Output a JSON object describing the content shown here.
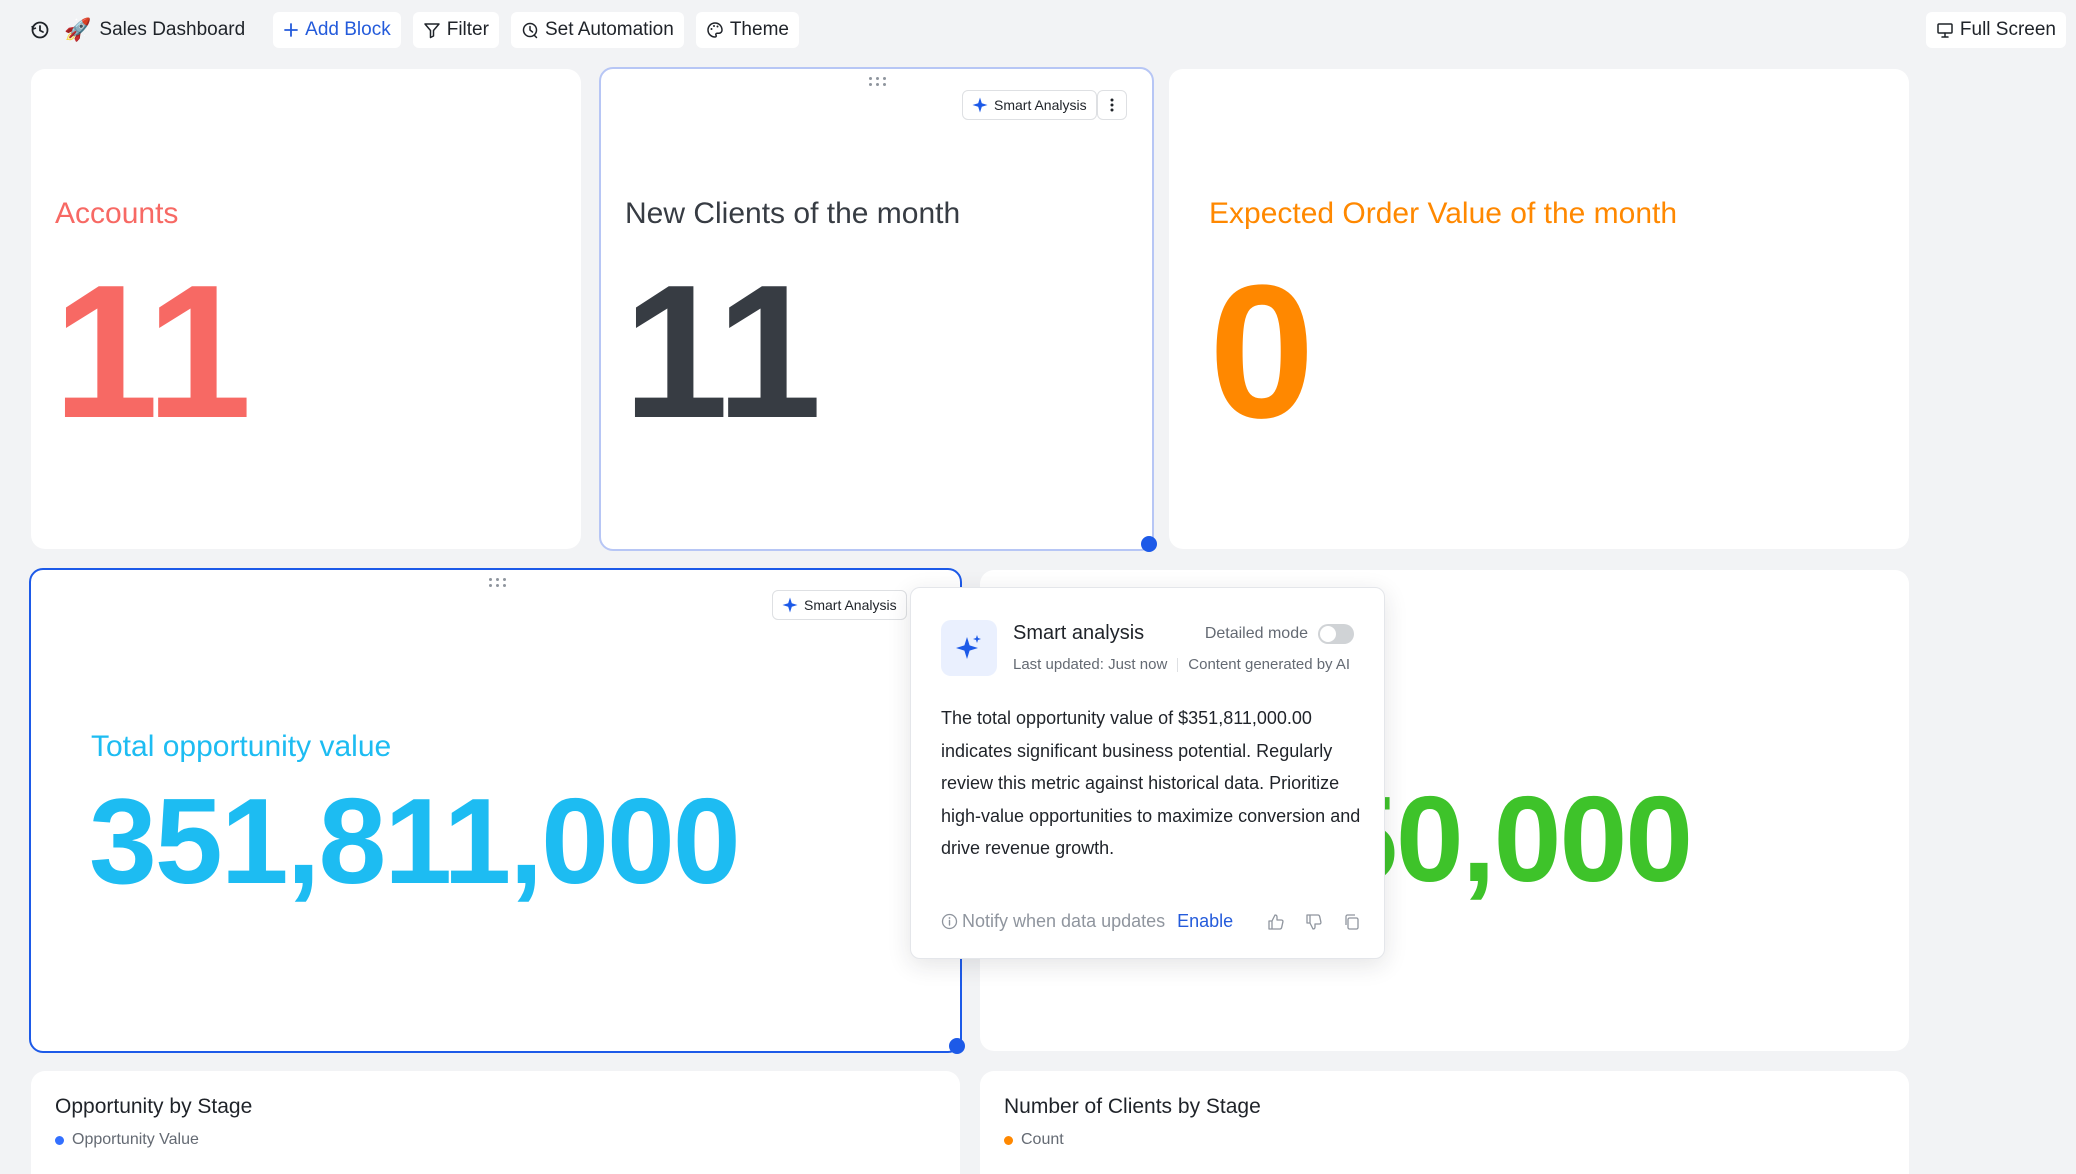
{
  "toolbar": {
    "dashboard_title": "Sales Dashboard",
    "add_block": "Add Block",
    "filter": "Filter",
    "set_automation": "Set Automation",
    "theme": "Theme",
    "full_screen": "Full Screen"
  },
  "kpis": [
    {
      "title": "Accounts",
      "value": "11",
      "color": "#f76964"
    },
    {
      "title": "New Clients of the month",
      "value": "11",
      "color": "#373c43"
    },
    {
      "title": "Expected Order Value of the month",
      "value": "0",
      "color": "#ff8800"
    },
    {
      "title": "Total opportunity value",
      "value": "351,811,000",
      "color": "#1dbcf2"
    },
    {
      "title": "",
      "value": "50,000",
      "color": "#3ec32a"
    }
  ],
  "smart_analysis_label": "Smart Analysis",
  "popover": {
    "title": "Smart analysis",
    "detailed_mode": "Detailed mode",
    "last_updated": "Last updated: Just now",
    "generated": "Content generated by AI",
    "body": "The total opportunity value of $351,811,000.00 indicates significant business potential. Regularly review this metric against historical data. Prioritize high-value opportunities to maximize conversion and drive revenue growth.",
    "notify": "Notify when data updates",
    "enable": "Enable"
  },
  "charts": [
    {
      "title": "Opportunity by Stage",
      "legend": "Opportunity Value",
      "legend_color": "#3370ff"
    },
    {
      "title": "Number of Clients by Stage",
      "legend": "Count",
      "legend_color": "#ff8800"
    }
  ]
}
